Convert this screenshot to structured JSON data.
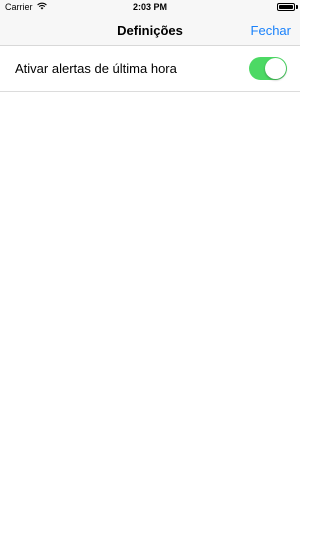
{
  "status_bar": {
    "carrier": "Carrier",
    "time": "2:03 PM",
    "wifi_icon": "wifi-icon",
    "battery_icon": "battery-icon",
    "battery_level": 1.0
  },
  "nav": {
    "title": "Definições",
    "close_label": "Fechar",
    "accent_color": "#1a82fb"
  },
  "settings": {
    "rows": [
      {
        "label": "Ativar alertas de última hora",
        "toggle_on": true,
        "toggle_color": "#4cd964"
      }
    ]
  }
}
